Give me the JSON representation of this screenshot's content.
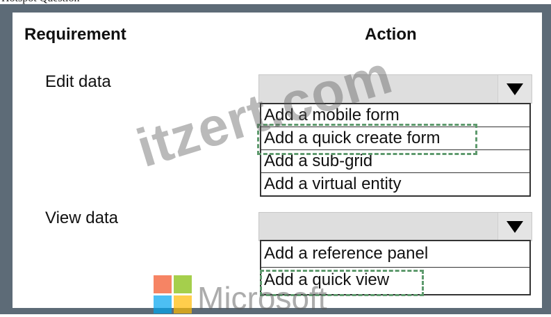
{
  "page_top_text": "Hotspot Question",
  "headers": {
    "requirement": "Requirement",
    "action": "Action"
  },
  "rows": [
    {
      "requirement": "Edit data",
      "options": [
        "Add a mobile form",
        "Add a quick create form",
        "Add a sub-grid",
        "Add a virtual entity"
      ],
      "highlighted": "Add a quick create form"
    },
    {
      "requirement": "View data",
      "options": [
        "Add a reference panel",
        "Add a quick view"
      ],
      "highlighted": "Add a quick view"
    }
  ],
  "watermark": {
    "text": "itzert.com",
    "brand": "Microsoft"
  },
  "colors": {
    "frame": "#5d6b77",
    "highlight_dash": "#5e9a6d"
  }
}
